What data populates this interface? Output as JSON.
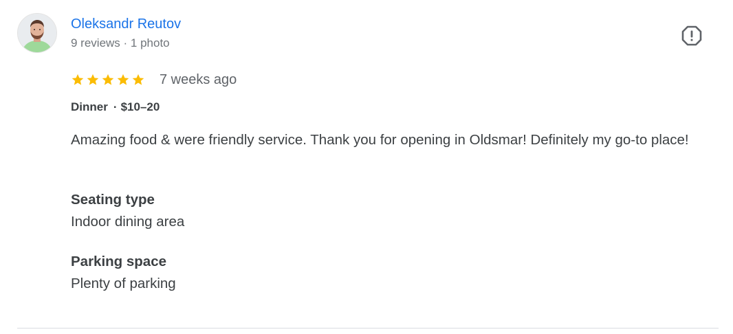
{
  "review": {
    "author": {
      "name": "Oleksandr Reutov",
      "meta": "9 reviews · 1 photo"
    },
    "rating": 5,
    "time": "7 weeks ago",
    "meal_type": "Dinner",
    "price_range": "$10–20",
    "text": "Amazing food & were friendly service. Thank you for opening in Oldsmar! Definitely my go-to place!",
    "attributes": [
      {
        "label": "Seating type",
        "value": "Indoor dining area"
      },
      {
        "label": "Parking space",
        "value": "Plenty of parking"
      }
    ]
  },
  "colors": {
    "author_link": "#1a73e8",
    "star": "#fbbc04",
    "text": "#3c4043",
    "muted": "#70757a",
    "divider": "#dadce0"
  },
  "icons": {
    "report": "report-flag-icon",
    "star": "star-icon"
  }
}
